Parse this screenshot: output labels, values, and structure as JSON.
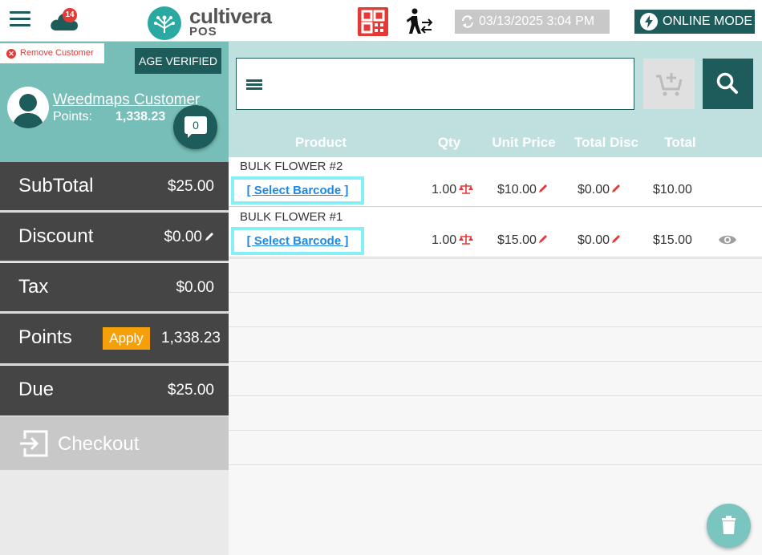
{
  "header": {
    "cloud_badge": "14",
    "brand_name": "cultivera",
    "brand_sub": "POS",
    "sync_datetime": "03/13/2025 3:04 PM",
    "online_mode_label": "ONLINE MODE"
  },
  "customer": {
    "remove_label": "Remove Customer",
    "age_badge": "AGE VERIFIED",
    "name": "Weedmaps Customer",
    "points_label": "Points:",
    "points_value": "1,338.23",
    "message_count": "0"
  },
  "summary": {
    "subtotal_label": "SubTotal",
    "subtotal_value": "$25.00",
    "discount_label": "Discount",
    "discount_value": "$0.00",
    "tax_label": "Tax",
    "tax_value": "$0.00",
    "points_label": "Points",
    "apply_label": "Apply",
    "points_value": "1,338.23",
    "due_label": "Due",
    "due_value": "$25.00",
    "checkout_label": "Checkout"
  },
  "search": {
    "placeholder": ""
  },
  "table": {
    "columns": [
      "Product",
      "Qty",
      "Unit Price",
      "Total Disc",
      "Total"
    ],
    "rows": [
      {
        "product": "BULK FLOWER #2",
        "barcode_label": "[ Select Barcode ]",
        "qty": "1.00",
        "unit_price": "$10.00",
        "total_disc": "$0.00",
        "total": "$10.00"
      },
      {
        "product": "BULK FLOWER #1",
        "barcode_label": "[ Select Barcode ]",
        "qty": "1.00",
        "unit_price": "$15.00",
        "total_disc": "$0.00",
        "total": "$15.00"
      }
    ]
  },
  "colors": {
    "brand_dark": "#1d5c5a",
    "brand_teal": "#76beb7",
    "alert_red": "#e53935",
    "apply_orange": "#f5a00b"
  }
}
